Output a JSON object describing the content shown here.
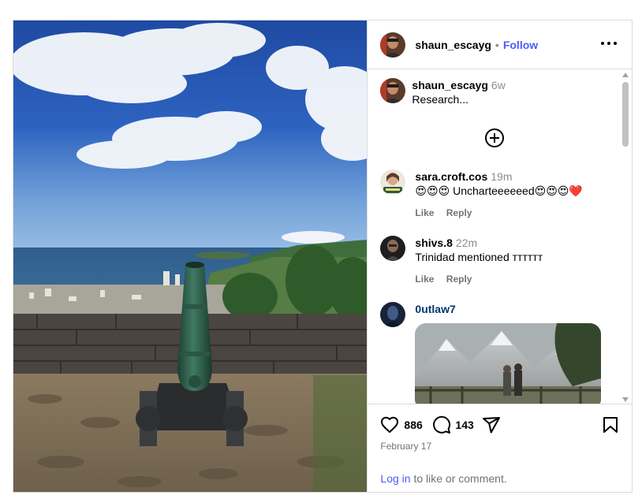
{
  "header": {
    "username": "shaun_escayg",
    "separator": "•",
    "follow_label": "Follow"
  },
  "caption": {
    "username": "shaun_escayg",
    "time": "6w",
    "text": "Research..."
  },
  "comments": [
    {
      "username": "sara.croft.cos",
      "time": "19m",
      "text": "😍😍😍 Unchartееееeed😍😍😍❤️",
      "like_label": "Like",
      "reply_label": "Reply"
    },
    {
      "username": "shivs.8",
      "time": "22m",
      "text": "Trinidad mentioned ᴛᴛᴛᴛᴛᴛ",
      "like_label": "Like",
      "reply_label": "Reply"
    },
    {
      "username": "0utlaw7"
    }
  ],
  "actions": {
    "likes": "886",
    "comments": "143"
  },
  "date": "February 17",
  "login": {
    "link_label": "Log in",
    "suffix": " to like or comment."
  },
  "colors": {
    "accent": "#4a5df9",
    "link_dark": "#00376b",
    "muted": "#737373",
    "border": "#dbdbdb"
  },
  "icons": [
    "heart-icon",
    "comment-icon",
    "share-icon",
    "bookmark-icon",
    "add-circle-icon",
    "more-icon"
  ]
}
